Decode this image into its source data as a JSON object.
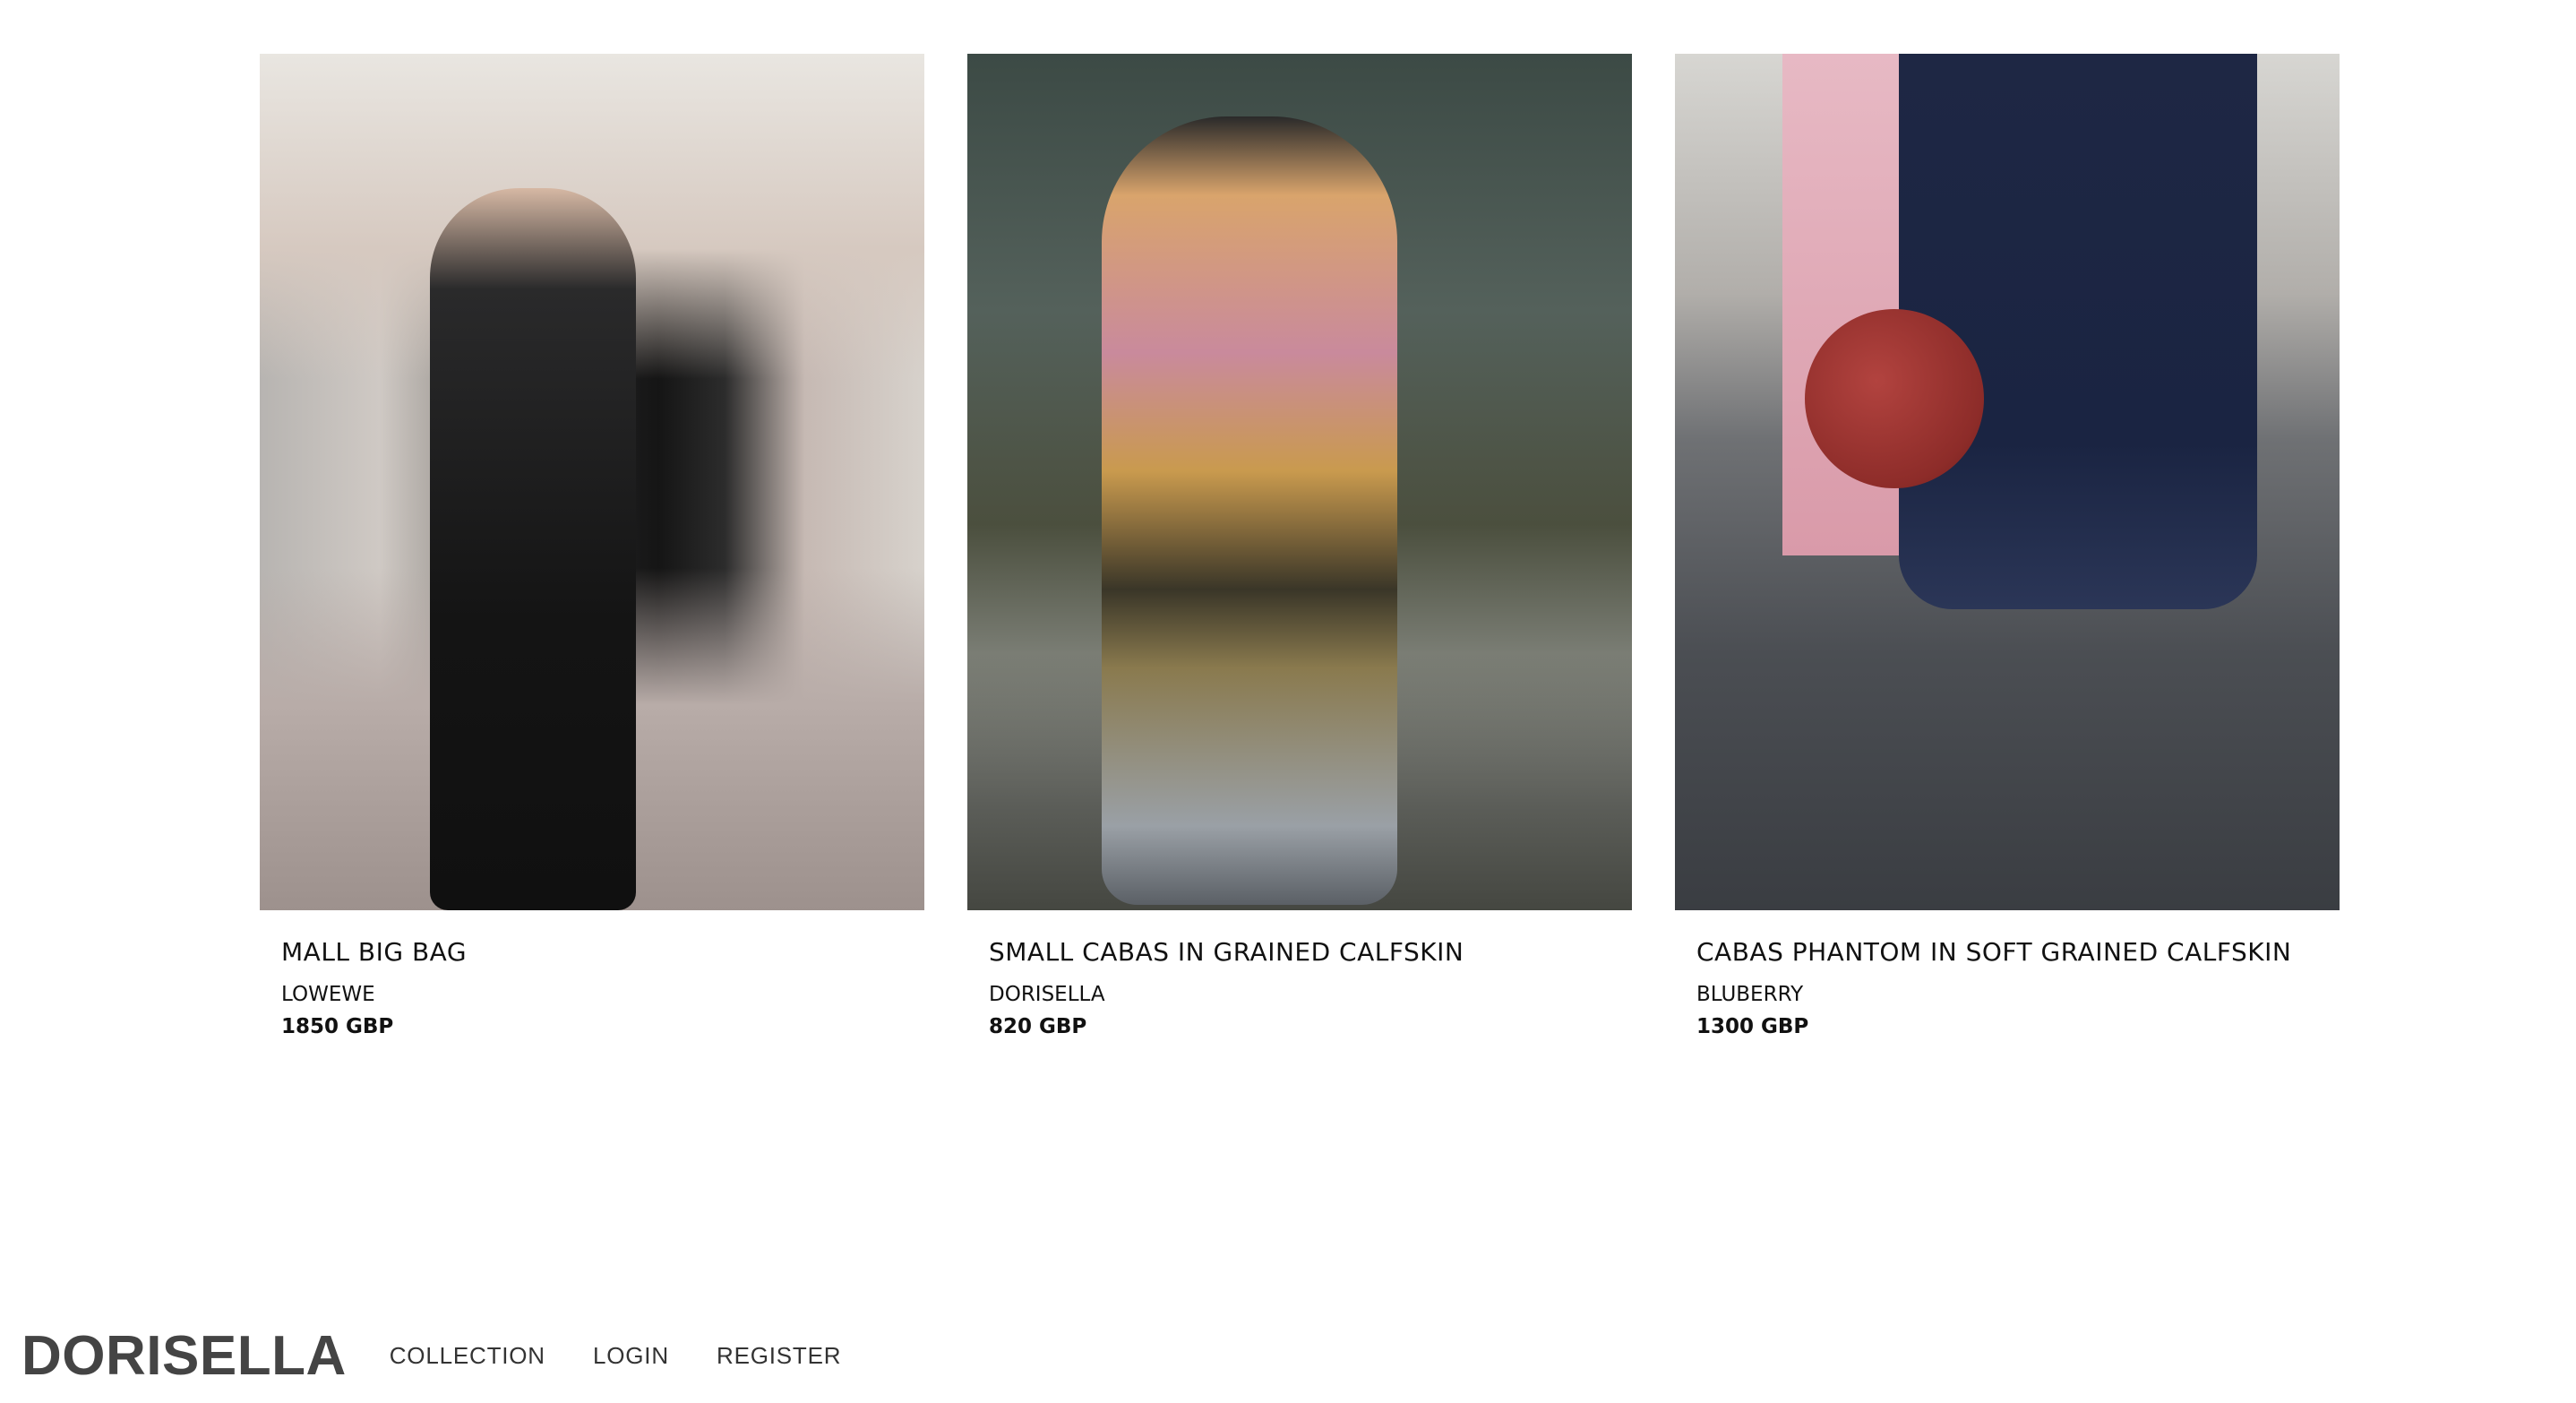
{
  "products": [
    {
      "title": "MALL BIG BAG",
      "brand": "LOWEWE",
      "price": "1850 GBP"
    },
    {
      "title": "SMALL CABAS IN GRAINED CALFSKIN",
      "brand": "DORISELLA",
      "price": "820 GBP"
    },
    {
      "title": "CABAS PHANTOM IN SOFT GRAINED CALFSKIN",
      "brand": "BLUBERRY",
      "price": "1300 GBP"
    }
  ],
  "footer": {
    "logo": "DORISELLA",
    "nav": [
      "COLLECTION",
      "LOGIN",
      "REGISTER"
    ]
  }
}
